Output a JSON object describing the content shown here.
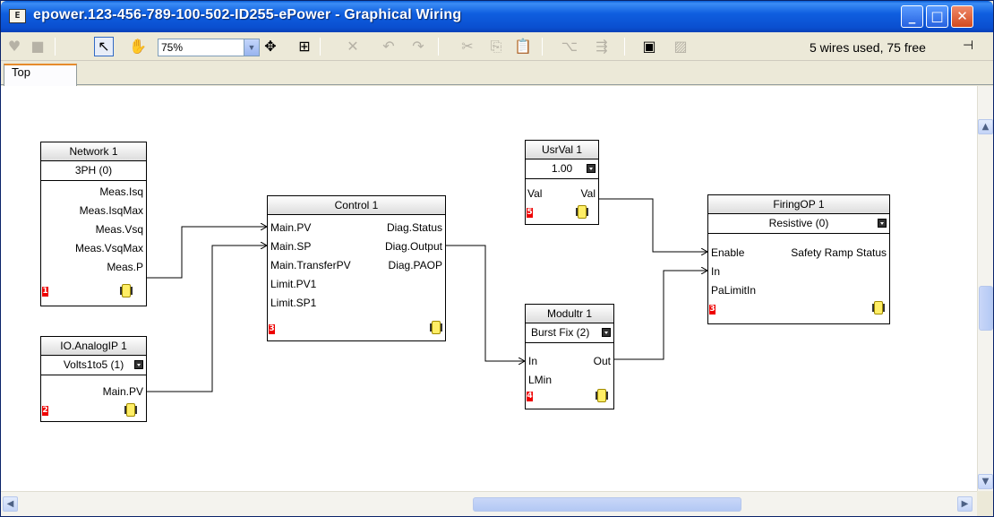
{
  "window": {
    "title": "epower.123-456-789-100-502-ID255-ePower - Graphical Wiring",
    "app_icon_label": "E",
    "minimize_glyph": "_",
    "maximize_glyph": "□",
    "close_glyph": "✕"
  },
  "toolbar": {
    "zoom_value": "75%",
    "wire_status": "5 wires used, 75 free",
    "icons": [
      "shape-icon",
      "square-icon",
      "pointer-icon",
      "pan-hand-icon",
      "move-icon",
      "grid-icon",
      "delete-icon",
      "undo-icon",
      "redo-icon",
      "cut-icon",
      "copy-icon",
      "paste-icon",
      "route-wire-icon",
      "route-wires-icon",
      "show-values-icon",
      "hide-values-icon",
      "pin-icon"
    ]
  },
  "tabs": [
    {
      "label": "Top"
    }
  ],
  "blocks": {
    "network": {
      "title": "Network 1",
      "mode": "3PH (0)",
      "pins_out": [
        "Meas.Isq",
        "Meas.IsqMax",
        "Meas.Vsq",
        "Meas.VsqMax",
        "Meas.P"
      ],
      "number": "1"
    },
    "analogip": {
      "title": "IO.AnalogIP 1",
      "mode": "Volts1to5 (1)",
      "pins_out": [
        "Main.PV"
      ],
      "number": "2"
    },
    "control": {
      "title": "Control 1",
      "pins_in": [
        "Main.PV",
        "Main.SP",
        "Main.TransferPV",
        "Limit.PV1",
        "Limit.SP1"
      ],
      "pins_out": [
        "Diag.Status",
        "Diag.Output",
        "Diag.PAOP"
      ],
      "number": "3"
    },
    "usrval": {
      "title": "UsrVal 1",
      "mode": "1.00",
      "pin_in": "Val",
      "pin_out": "Val",
      "number": "5"
    },
    "modultr": {
      "title": "Modultr 1",
      "mode": "Burst Fix (2)",
      "pins_in": [
        "In",
        "LMin"
      ],
      "pin_out": "Out",
      "number": "4"
    },
    "firingop": {
      "title": "FiringOP 1",
      "mode": "Resistive (0)",
      "pins_in": [
        "Enable",
        "In",
        "PaLimitIn"
      ],
      "pin_out": "Safety Ramp Status",
      "number": "3"
    }
  },
  "colors": {
    "title_bar": "#0a4fd0",
    "wire": "#000000",
    "block_number": "#ee0000",
    "exec_icon": "#ffee66",
    "tab_highlight": "#e68b2c"
  }
}
